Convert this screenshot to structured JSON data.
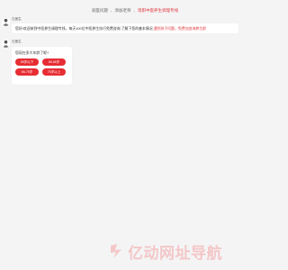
{
  "breadcrumb": {
    "items": [
      "就医问题",
      "添加老师",
      "现职中医养生调理专线"
    ]
  },
  "messages": [
    {
      "sender": "丘医生",
      "text": "您好!欢迎来到中医养生调理专线，每天100位中医养生技巧免费咨询,了解下您的基本情况,",
      "link": "遇到孩子问题，免费加咨询养生群"
    },
    {
      "sender": "丘医生",
      "question": "您现在多大年龄了呢?",
      "options": [
        "55岁以下",
        "56-65岁",
        "66-75岁",
        "76岁以上"
      ]
    }
  ],
  "footer": {
    "brand": "亿动网址导航"
  },
  "colors": {
    "accent": "#e62d33",
    "background": "#f4f4f5"
  }
}
